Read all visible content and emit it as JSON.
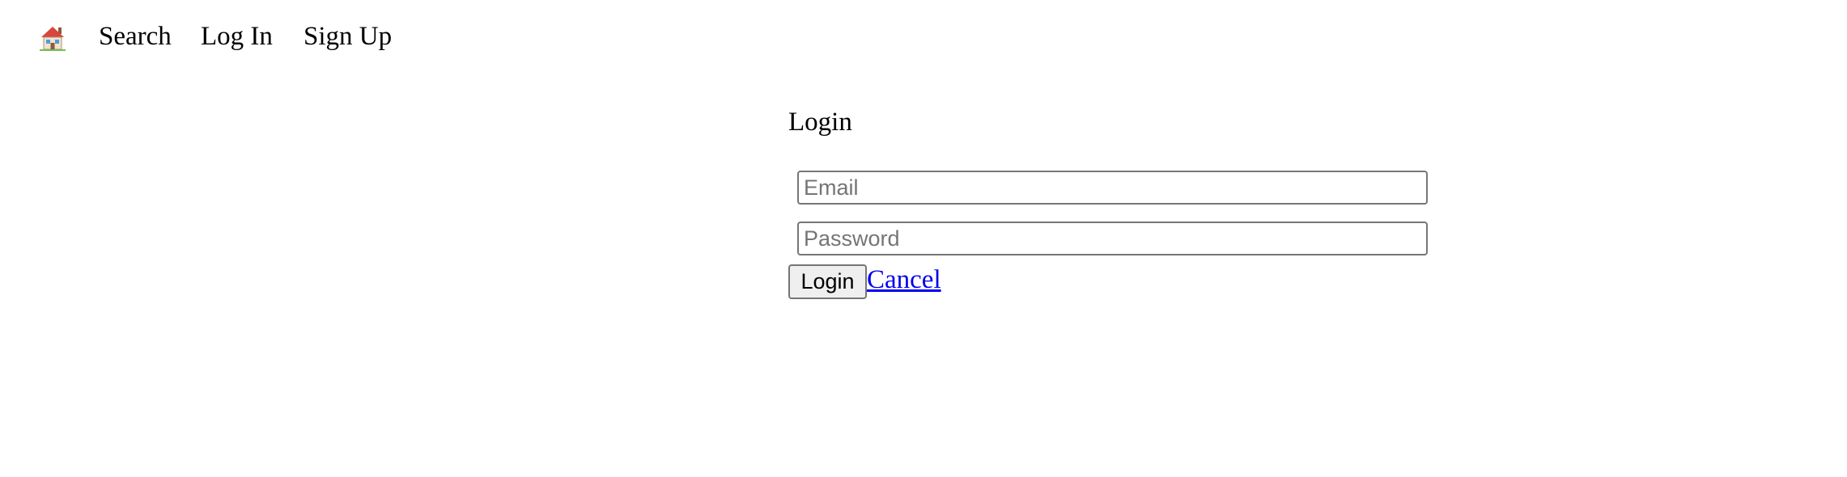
{
  "nav": {
    "home_icon": "house-emoji-icon",
    "items": [
      {
        "label": "Search"
      },
      {
        "label": "Log In"
      },
      {
        "label": "Sign Up"
      }
    ]
  },
  "login": {
    "title": "Login",
    "email": {
      "value": "",
      "placeholder": "Email"
    },
    "password": {
      "value": "",
      "placeholder": "Password"
    },
    "submit_label": "Login",
    "cancel_label": "Cancel"
  },
  "colors": {
    "background": "#ffffff",
    "text": "#000000",
    "link": "#0000ee",
    "input_border": "#767676",
    "button_background": "#efefef",
    "placeholder": "#757575"
  }
}
